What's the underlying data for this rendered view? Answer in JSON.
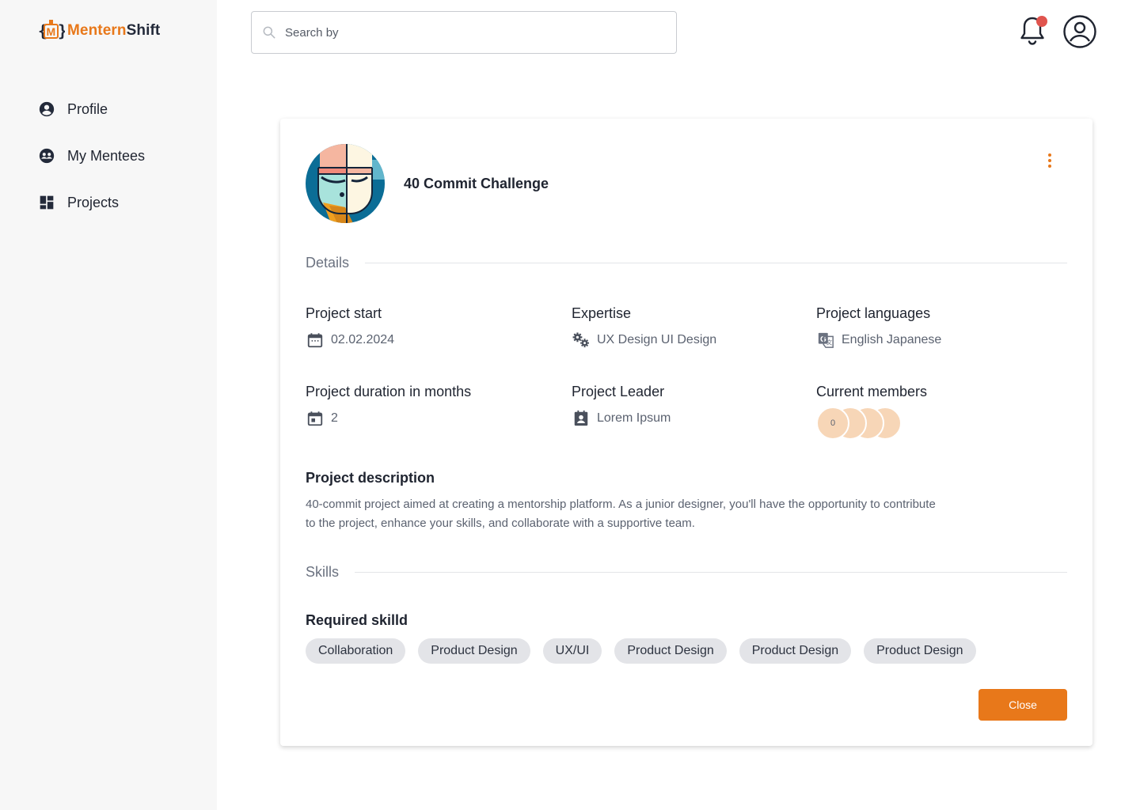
{
  "brand": {
    "part1": "Mentern",
    "part2": "Shift",
    "accent": "#e8781a",
    "dark": "#232a3a"
  },
  "sidebar": {
    "items": [
      {
        "label": "Profile",
        "icon": "account-circle-icon"
      },
      {
        "label": "My Mentees",
        "icon": "group-icon"
      },
      {
        "label": "Projects",
        "icon": "dashboard-icon"
      }
    ]
  },
  "search": {
    "placeholder": "Search by",
    "value": ""
  },
  "header": {
    "notification_icon": "bell-icon",
    "has_notification": true,
    "user_icon": "user-circle-icon"
  },
  "project": {
    "title": "40 Commit Challenge",
    "details_heading": "Details",
    "fields": {
      "start": {
        "label": "Project start",
        "value": "02.02.2024",
        "icon": "calendar-icon"
      },
      "expertise": {
        "label": "Expertise",
        "value": "UX Design UI Design",
        "icon": "gears-icon"
      },
      "languages": {
        "label": "Project languages",
        "value": "English Japanese",
        "icon": "translate-icon"
      },
      "duration": {
        "label": "Project duration in months",
        "value": "2",
        "icon": "calendar-event-icon"
      },
      "leader": {
        "label": "Project Leader",
        "value": "Lorem Ipsum",
        "icon": "contact-icon"
      },
      "members": {
        "label": "Current members",
        "count_label": "0",
        "avatars": 4
      }
    },
    "description_label": "Project description",
    "description": "40-commit project aimed at creating a mentorship platform. As a junior designer, you'll have the opportunity to contribute to the project, enhance your skills, and collaborate with a supportive team.",
    "skills_heading": "Skills",
    "required_label": "Required skilld",
    "skills": [
      "Collaboration",
      "Product Design",
      "UX/UI",
      "Product Design",
      "Product Design",
      "Product Design"
    ],
    "close_label": "Close"
  }
}
